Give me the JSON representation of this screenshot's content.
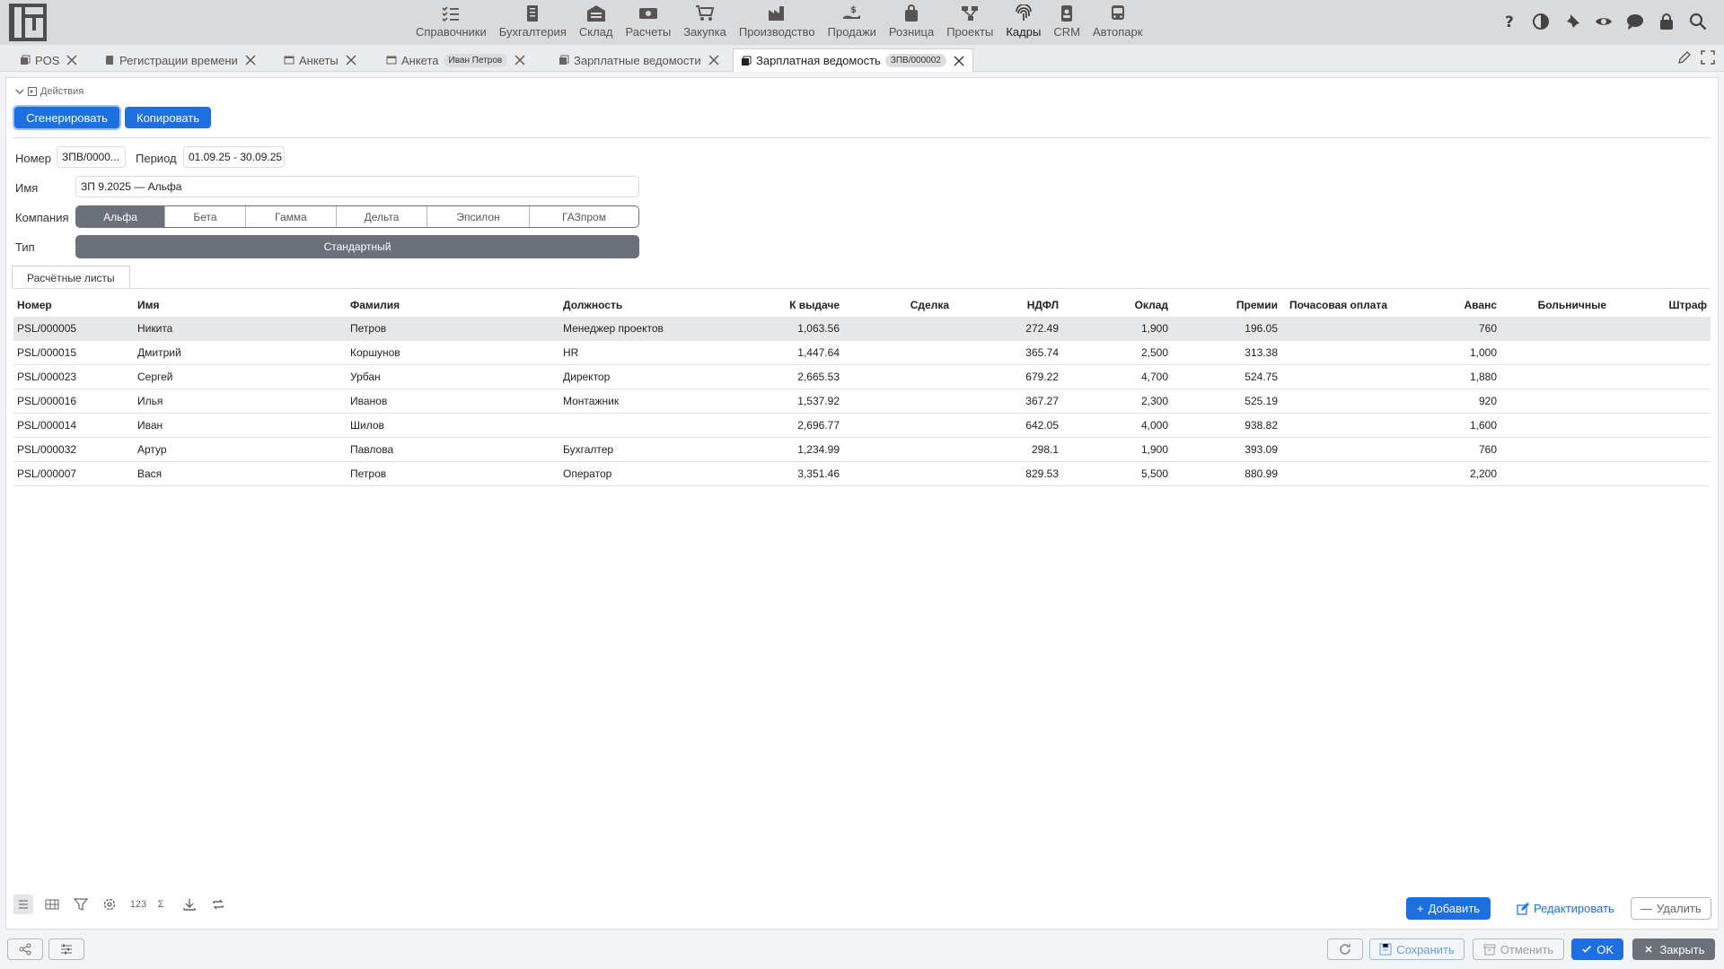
{
  "nav": {
    "items": [
      {
        "label": "Справочники",
        "icon": "list-check-icon"
      },
      {
        "label": "Бухгалтерия",
        "icon": "ledger-icon"
      },
      {
        "label": "Склад",
        "icon": "warehouse-icon"
      },
      {
        "label": "Расчеты",
        "icon": "money-icon"
      },
      {
        "label": "Закупка",
        "icon": "cart-icon"
      },
      {
        "label": "Производство",
        "icon": "factory-icon"
      },
      {
        "label": "Продажи",
        "icon": "hand-dollar-icon"
      },
      {
        "label": "Розница",
        "icon": "bag-icon"
      },
      {
        "label": "Проекты",
        "icon": "project-icon"
      },
      {
        "label": "Кадры",
        "icon": "fingerprint-icon"
      },
      {
        "label": "CRM",
        "icon": "contact-icon"
      },
      {
        "label": "Автопарк",
        "icon": "bus-icon"
      }
    ],
    "active": "Кадры"
  },
  "tabs": [
    {
      "label": "POS",
      "badge": ""
    },
    {
      "label": "Регистрации времени",
      "badge": ""
    },
    {
      "label": "Анкеты",
      "badge": ""
    },
    {
      "label": "Анкета",
      "badge": "Иван Петров"
    },
    {
      "label": "Зарплатные ведомости",
      "badge": ""
    },
    {
      "label": "Зарплатная ведомость",
      "badge": "ЗПВ/000002"
    }
  ],
  "actions": {
    "toggle_label": "Действия",
    "generate_label": "Сгенерировать",
    "copy_label": "Копировать"
  },
  "form": {
    "number_label": "Номер",
    "number_value": "ЗПВ/0000...",
    "period_label": "Период",
    "period_value": "01.09.25 - 30.09.25",
    "name_label": "Имя",
    "name_value": "ЗП 9.2025 — Альфа",
    "company_label": "Компания",
    "companies": [
      "Альфа",
      "Бета",
      "Гамма",
      "Дельта",
      "Эпсилон",
      "ГАЗпром"
    ],
    "company_selected": "Альфа",
    "type_label": "Тип",
    "type_value": "Стандартный"
  },
  "subtab": "Расчётные листы",
  "table": {
    "columns": [
      "Номер",
      "Имя",
      "Фамилия",
      "Должность",
      "К выдаче",
      "Сделка",
      "НДФЛ",
      "Оклад",
      "Премии",
      "Почасовая оплата",
      "Аванс",
      "Больничные",
      "Штраф"
    ],
    "rows": [
      [
        "PSL/000005",
        "Никита",
        "Петров",
        "Менеджер проектов",
        "1,063.56",
        "",
        "272.49",
        "1,900",
        "196.05",
        "",
        "760",
        "",
        ""
      ],
      [
        "PSL/000015",
        "Дмитрий",
        "Коршунов",
        "HR",
        "1,447.64",
        "",
        "365.74",
        "2,500",
        "313.38",
        "",
        "1,000",
        "",
        ""
      ],
      [
        "PSL/000023",
        "Сергей",
        "Урбан",
        "Директор",
        "2,665.53",
        "",
        "679.22",
        "4,700",
        "524.75",
        "",
        "1,880",
        "",
        ""
      ],
      [
        "PSL/000016",
        "Илья",
        "Иванов",
        "Монтажник",
        "1,537.92",
        "",
        "367.27",
        "2,300",
        "525.19",
        "",
        "920",
        "",
        ""
      ],
      [
        "PSL/000014",
        "Иван",
        "Шилов",
        "",
        "2,696.77",
        "",
        "642.05",
        "4,000",
        "938.82",
        "",
        "1,600",
        "",
        ""
      ],
      [
        "PSL/000032",
        "Артур",
        "Павлова",
        "Бухгалтер",
        "1,234.99",
        "",
        "298.1",
        "1,900",
        "393.09",
        "",
        "760",
        "",
        ""
      ],
      [
        "PSL/000007",
        "Вася",
        "Петров",
        "Оператор",
        "3,351.46",
        "",
        "829.53",
        "5,500",
        "880.99",
        "",
        "2,200",
        "",
        ""
      ]
    ]
  },
  "bottom_tools": {
    "sum_label": "123",
    "add_label": "Добавить",
    "edit_label": "Редактировать",
    "delete_label": "Удалить"
  },
  "footer": {
    "save_label": "Сохранить",
    "cancel_label": "Отменить",
    "ok_label": "OK",
    "close_label": "Закрыть"
  },
  "colors": {
    "accent": "#1e6fe0",
    "segment_active": "#6b7079",
    "topbar": "#d9dadc"
  }
}
